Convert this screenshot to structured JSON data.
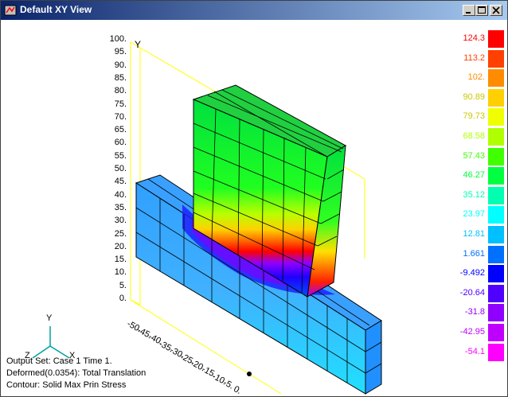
{
  "window": {
    "title": "Default XY View"
  },
  "status": {
    "output_set": "Output Set: Case 1 Time 1.",
    "deformed": "Deformed(0.0354): Total Translation",
    "contour": "Contour: Solid Max Prin Stress"
  },
  "axes": {
    "y_label": "Y",
    "y_ticks": [
      "100.",
      "95.",
      "90.",
      "85.",
      "80.",
      "75.",
      "70.",
      "65.",
      "60.",
      "55.",
      "50.",
      "45.",
      "40.",
      "35.",
      "30.",
      "25.",
      "20.",
      "15.",
      "10.",
      "5.",
      "0."
    ],
    "x_ticks": [
      "-50.",
      "-45.",
      "-40.",
      "-35.",
      "-30.",
      "-25.",
      "-20.",
      "-15.",
      "-10.",
      "-5.",
      "0."
    ],
    "triad": {
      "y": "Y",
      "z": "Z",
      "x": "X"
    }
  },
  "legend": [
    {
      "label": "124.3",
      "color": "#ff0000"
    },
    {
      "label": "113.2",
      "color": "#ff4000"
    },
    {
      "label": "102.",
      "color": "#ff8c00"
    },
    {
      "label": "90.89",
      "color": "#ffd000"
    },
    {
      "label": "79.73",
      "color": "#f0ff00"
    },
    {
      "label": "68.58",
      "color": "#b0ff00"
    },
    {
      "label": "57.43",
      "color": "#40ff00"
    },
    {
      "label": "46.27",
      "color": "#00ff40"
    },
    {
      "label": "35.12",
      "color": "#00ffb0"
    },
    {
      "label": "23.97",
      "color": "#00ffff"
    },
    {
      "label": "12.81",
      "color": "#00c0ff"
    },
    {
      "label": "1.661",
      "color": "#0070ff"
    },
    {
      "label": "-9.492",
      "color": "#0000ff"
    },
    {
      "label": "-20.64",
      "color": "#5000ff"
    },
    {
      "label": "-31.8",
      "color": "#9000ff"
    },
    {
      "label": "-42.95",
      "color": "#c000ff"
    },
    {
      "label": "-54.1",
      "color": "#ff00ff"
    }
  ]
}
